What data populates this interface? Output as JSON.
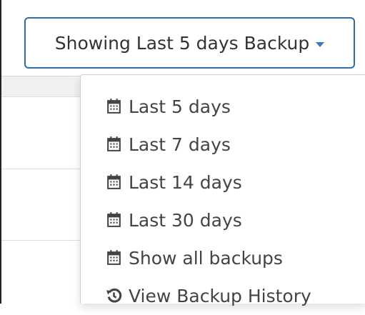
{
  "toggle": {
    "label": "Showing Last 5 days Backup"
  },
  "menu": {
    "items": [
      {
        "label": "Last 5 days",
        "icon": "calendar-icon"
      },
      {
        "label": "Last 7 days",
        "icon": "calendar-icon"
      },
      {
        "label": "Last 14 days",
        "icon": "calendar-icon"
      },
      {
        "label": "Last 30 days",
        "icon": "calendar-icon"
      },
      {
        "label": "Show all backups",
        "icon": "calendar-icon"
      },
      {
        "label": "View Backup History",
        "icon": "history-icon"
      }
    ]
  },
  "colors": {
    "accent": "#337ab7",
    "toggle_border": "#2e6da4",
    "text": "#333333"
  }
}
